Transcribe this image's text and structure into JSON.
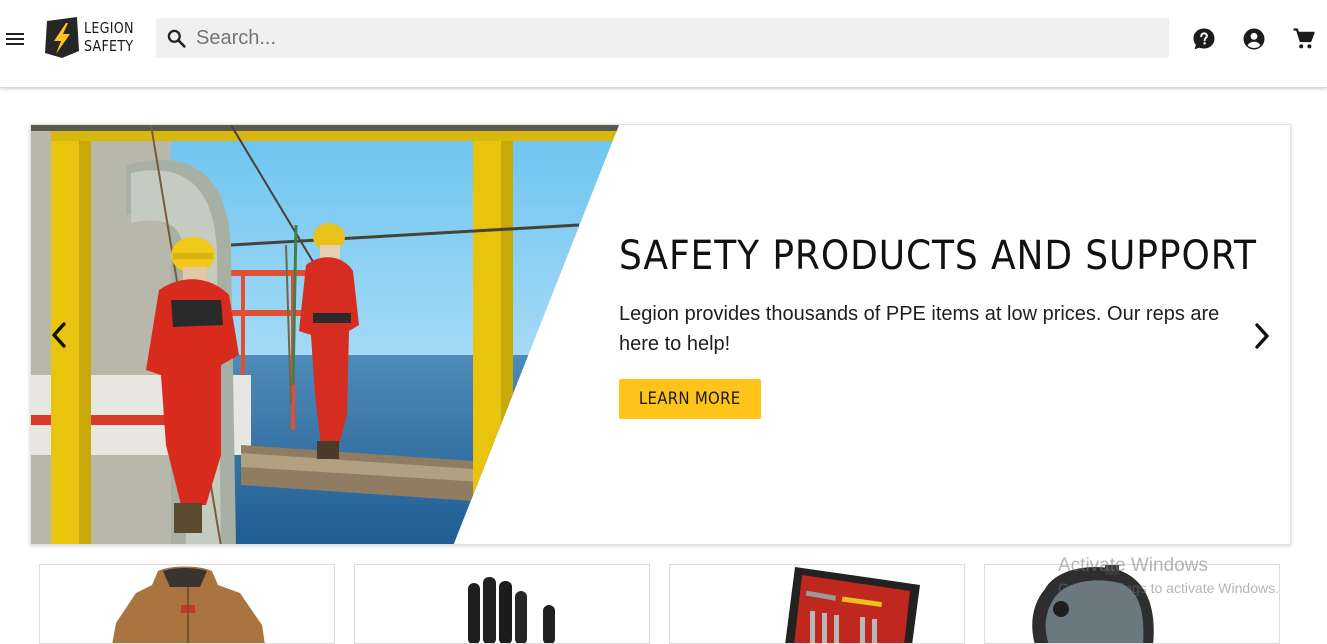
{
  "header": {
    "menu_icon": "hamburger-menu-icon",
    "logo_text": "LEGION\nSAFETY",
    "search": {
      "placeholder": "Search...",
      "value": ""
    },
    "icons": [
      "help-icon",
      "account-icon",
      "cart-icon"
    ]
  },
  "hero": {
    "title": "SAFETY PRODUCTS AND SUPPORT",
    "description": "Legion provides thousands of PPE items at low prices. Our reps are here to help!",
    "button_label": "LEARN MORE",
    "accent_color": "#fec41a",
    "prev_icon": "chevron-left-icon",
    "next_icon": "chevron-right-icon"
  },
  "categories": [
    {
      "icon": "work-jacket-image"
    },
    {
      "icon": "black-glove-image"
    },
    {
      "icon": "tool-kit-case-image"
    },
    {
      "icon": "full-face-respirator-image"
    }
  ],
  "watermark": {
    "title": "Activate Windows",
    "subtitle": "Go to Settings to activate Windows."
  }
}
